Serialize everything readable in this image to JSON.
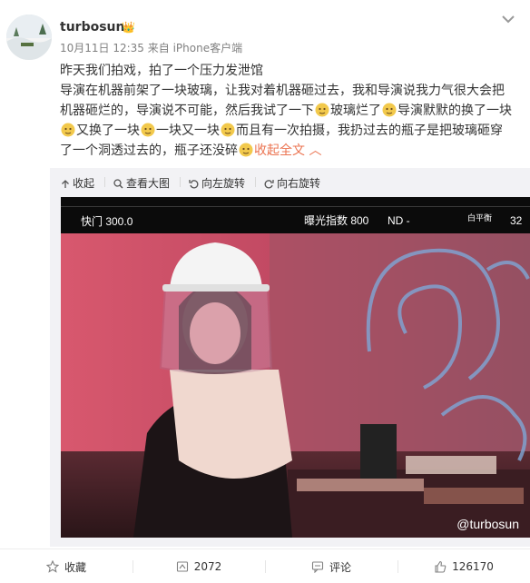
{
  "post": {
    "username": "turbosun",
    "timestamp": "10月11日 12:35",
    "source": "来自 iPhone客户端",
    "lines": [
      "昨天我们拍戏，拍了一个压力发泄馆",
      "导演在机器前架了一块玻璃，让我对着机器砸过去，我和导演说我力气很大会把",
      "机器砸烂的，导演说不可能，然后我试了一下",
      "玻璃烂了",
      "导演默默的换了一块",
      "又换了一块",
      "一块又一块",
      "而且有一次拍摄，我扔过去的瓶子是把玻璃砸穿",
      "了一个洞透过去的，瓶子还没碎"
    ],
    "expand_label": "收起全文",
    "emoji_icon": "doge-emoji-icon"
  },
  "toolbar": {
    "collapse": "收起",
    "view_large": "查看大图",
    "rotate_left": "向左旋转",
    "rotate_right": "向右旋转"
  },
  "photo": {
    "hud": {
      "shutter": "快门 300.0",
      "exposure": "曝光指数 800",
      "nd": "ND -",
      "white_balance": "白平衡",
      "wb_value": "32"
    },
    "watermark": "@turbosun"
  },
  "actions": {
    "favorite": "收藏",
    "repost_count": "2072",
    "comment": "评论",
    "like_count": "126170"
  },
  "colors": {
    "accent": "#eb7350",
    "verified": "#e8801d",
    "meta_gray": "#808080"
  }
}
